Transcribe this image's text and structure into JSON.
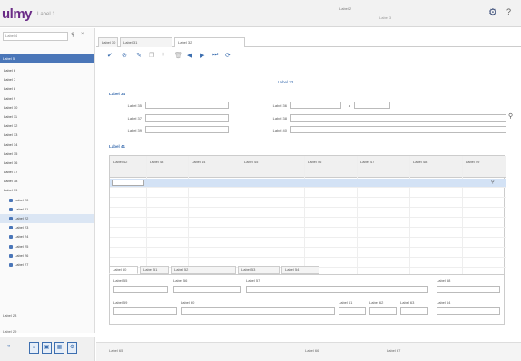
{
  "topbar": {
    "logo": "ulmy",
    "app_name": "Label 1",
    "user": "Label 2",
    "session": "Label 3"
  },
  "sidebar": {
    "search_placeholder": "Label 4",
    "header": "Label 5",
    "items": [
      {
        "label": "Label 6",
        "child": false
      },
      {
        "label": "Label 7",
        "child": false
      },
      {
        "label": "Label 8",
        "child": false
      },
      {
        "label": "Label 9",
        "child": false
      },
      {
        "label": "Label 10",
        "child": false
      },
      {
        "label": "Label 11",
        "child": false
      },
      {
        "label": "Label 12",
        "child": false
      },
      {
        "label": "Label 13",
        "child": false
      },
      {
        "label": "Label 14",
        "child": false
      },
      {
        "label": "Label 15",
        "child": false
      },
      {
        "label": "Label 16",
        "child": false
      },
      {
        "label": "Label 17",
        "child": false
      },
      {
        "label": "Label 18",
        "child": false
      },
      {
        "label": "Label 19",
        "child": false
      },
      {
        "label": "Label 20",
        "child": true
      },
      {
        "label": "Label 21",
        "child": true
      },
      {
        "label": "Label 22",
        "child": true
      },
      {
        "label": "Label 23",
        "child": true
      },
      {
        "label": "Label 24",
        "child": true
      },
      {
        "label": "Label 25",
        "child": true
      },
      {
        "label": "Label 26",
        "child": true
      },
      {
        "label": "Label 27",
        "child": true
      }
    ],
    "bottom_title": "Label 28",
    "bottom_sub": "Label 29"
  },
  "tabs": [
    "Label 30",
    "Label 31",
    "Label 32"
  ],
  "form": {
    "title": "Label 33",
    "section1": "Label 34",
    "labels": [
      "Label 35",
      "Label 36",
      "Label 37",
      "Label 38",
      "Label 39",
      "Label 40"
    ],
    "section2": "Label 41"
  },
  "grid": {
    "columns": [
      "Label 42",
      "Label 43",
      "Label 44",
      "Label 45",
      "Label 46",
      "Label 47",
      "Label 48",
      "Label 49"
    ]
  },
  "subtabs": [
    "Label 50",
    "Label 51",
    "Label 52",
    "Label 53",
    "Label 54"
  ],
  "subpanel": {
    "labels": [
      "Label 55",
      "Label 56",
      "Label 57",
      "Label 58",
      "Label 59",
      "Label 60",
      "Label 61",
      "Label 62",
      "Label 63",
      "Label 64"
    ]
  },
  "status": {
    "left": "Label 65",
    "middle": "Label 66",
    "right": "Label 67"
  },
  "colors": {
    "brand": "#6a2b86",
    "accent": "#4a76b8"
  }
}
